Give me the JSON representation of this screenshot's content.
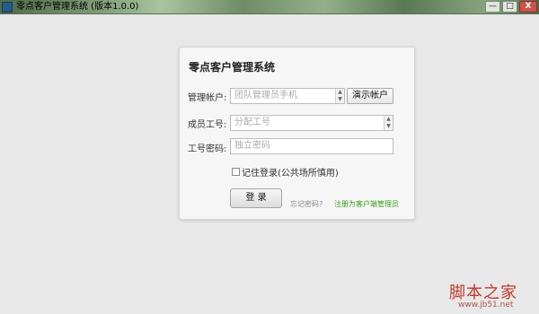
{
  "window": {
    "title": "零点客户管理系统 (版本1.0.0)",
    "min_label": "—",
    "max_label": "□",
    "close_label": "X"
  },
  "login": {
    "title": "零点客户管理系统",
    "account_label": "管理帐户:",
    "account_placeholder": "团队管理员手机",
    "demo_button": "演示帐户",
    "member_label": "成员工号:",
    "member_placeholder": "分配工号",
    "password_label": "工号密码:",
    "password_placeholder": "独立密码",
    "remember_label": "记住登录(公共场所慎用)",
    "remember_checked": false,
    "login_button": "登 录",
    "forgot_link": "忘记密码?",
    "register_link": "注册为客户端管理员"
  },
  "watermark": {
    "logo_text": "脚本之家",
    "url": "www.jb51.net"
  },
  "colors": {
    "register_link": "#3a9a1a",
    "watermark": "#c0392b",
    "background": "#e8e8e8"
  }
}
